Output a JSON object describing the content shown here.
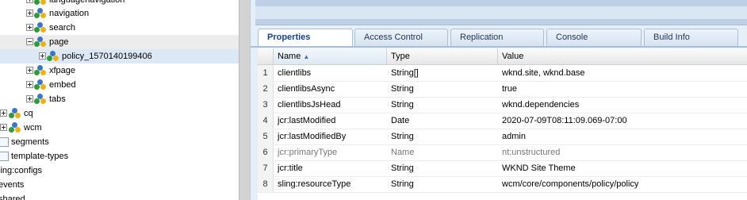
{
  "tree": {
    "items": [
      {
        "label": "languagenavigation"
      },
      {
        "label": "navigation"
      },
      {
        "label": "search"
      },
      {
        "label": "page"
      },
      {
        "label": "policy_1570140199406"
      },
      {
        "label": "xfpage"
      },
      {
        "label": "embed"
      },
      {
        "label": "tabs"
      },
      {
        "label": "cq"
      },
      {
        "label": "wcm"
      },
      {
        "label": "segments"
      },
      {
        "label": "template-types"
      },
      {
        "label": "ling:configs"
      },
      {
        "label": "events"
      },
      {
        "label": "shared"
      }
    ]
  },
  "tabs": [
    {
      "label": "Properties"
    },
    {
      "label": "Access Control"
    },
    {
      "label": "Replication"
    },
    {
      "label": "Console"
    },
    {
      "label": "Build Info"
    }
  ],
  "grid": {
    "columns": {
      "name": "Name",
      "type": "Type",
      "value": "Value"
    },
    "sort_indicator": "▲",
    "rows": [
      {
        "num": "1",
        "name": "clientlibs",
        "type": "String[]",
        "value": "wknd.site, wknd.base"
      },
      {
        "num": "2",
        "name": "clientlibsAsync",
        "type": "String",
        "value": "true"
      },
      {
        "num": "3",
        "name": "clientlibsJsHead",
        "type": "String",
        "value": "wknd.dependencies"
      },
      {
        "num": "4",
        "name": "jcr:lastModified",
        "type": "Date",
        "value": "2020-07-09T08:11:09.069-07:00"
      },
      {
        "num": "5",
        "name": "jcr:lastModifiedBy",
        "type": "String",
        "value": "admin"
      },
      {
        "num": "6",
        "name": "jcr:primaryType",
        "type": "Name",
        "value": "nt:unstructured"
      },
      {
        "num": "7",
        "name": "jcr:title",
        "type": "String",
        "value": "WKND Site Theme"
      },
      {
        "num": "8",
        "name": "sling:resourceType",
        "type": "String",
        "value": "wcm/core/components/policy/policy"
      }
    ]
  }
}
